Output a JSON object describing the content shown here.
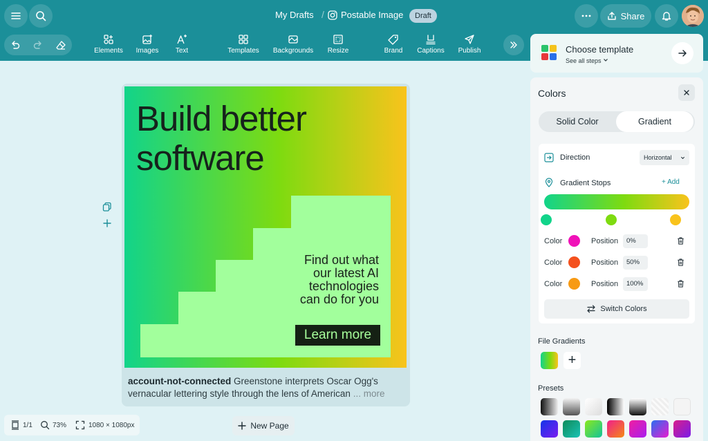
{
  "topbar": {
    "breadcrumb_parent": "My Drafts",
    "document_title": "Postable Image",
    "status_badge": "Draft",
    "share_label": "Share"
  },
  "toolbar": {
    "tools": [
      "Elements",
      "Images",
      "Text",
      "Templates",
      "Backgrounds",
      "Resize",
      "Brand",
      "Captions",
      "Publish"
    ]
  },
  "artboard": {
    "headline_line1": "Build better",
    "headline_line2": "software",
    "promo_line1": "Find out what",
    "promo_line2": "our latest AI",
    "promo_line3": "technologies",
    "promo_line4": "can do for you",
    "cta_label": "Learn more"
  },
  "caption": {
    "account": "account-not-connected",
    "text": " Greenstone interprets Oscar Ogg's vernacular lettering style through the lens of American",
    "ellipsis": " ... ",
    "more_label": "more"
  },
  "bottombar": {
    "page_count": "1/1",
    "zoom": "73%",
    "dimensions": "1080 × 1080px",
    "new_page_label": "New Page"
  },
  "template_card": {
    "title": "Choose template",
    "subtitle": "See all steps"
  },
  "colors_panel": {
    "title": "Colors",
    "tab_solid": "Solid Color",
    "tab_gradient": "Gradient",
    "active_tab": "Gradient",
    "direction_label": "Direction",
    "direction_value": "Horizontal",
    "stops_label": "Gradient Stops",
    "add_label": "Add",
    "gradient_start": "#12d48a",
    "gradient_mid": "#7edb10",
    "gradient_end": "#f9c31c",
    "stops": [
      {
        "color_label": "Color",
        "color": "#f012b8",
        "position_label": "Position",
        "position": "0%"
      },
      {
        "color_label": "Color",
        "color": "#f4511e",
        "position_label": "Position",
        "position": "50%"
      },
      {
        "color_label": "Color",
        "color": "#f79a14",
        "position_label": "Position",
        "position": "100%"
      }
    ],
    "switch_label": "Switch Colors",
    "file_gradients_label": "File Gradients",
    "presets_label": "Presets"
  }
}
